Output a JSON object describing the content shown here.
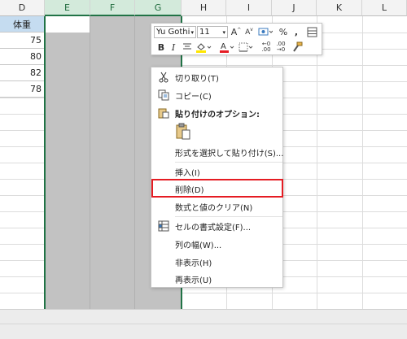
{
  "columns": [
    {
      "label": "D"
    },
    {
      "label": "E"
    },
    {
      "label": "F"
    },
    {
      "label": "G"
    },
    {
      "label": "H"
    },
    {
      "label": "I"
    },
    {
      "label": "J"
    },
    {
      "label": "K"
    },
    {
      "label": "L"
    }
  ],
  "column_d": {
    "header": "体重",
    "values": [
      "75",
      "80",
      "82",
      "78"
    ]
  },
  "mini_toolbar": {
    "font_name": "Yu Gothi",
    "font_size": "11",
    "bold": "B",
    "italic": "I",
    "percent": "%",
    "comma": ","
  },
  "context_menu": {
    "items": [
      {
        "label": "切り取り(T)",
        "icon": "scissors-icon"
      },
      {
        "label": "コピー(C)",
        "icon": "copy-icon"
      },
      {
        "label": "貼り付けのオプション:",
        "icon": "paste-options-icon"
      },
      {
        "label": "形式を選択して貼り付け(S)..."
      },
      {
        "label": "挿入(I)"
      },
      {
        "label": "削除(D)"
      },
      {
        "label": "数式と値のクリア(N)"
      },
      {
        "label": "セルの書式設定(F)...",
        "icon": "format-cells-icon"
      },
      {
        "label": "列の幅(W)..."
      },
      {
        "label": "非表示(H)"
      },
      {
        "label": "再表示(U)"
      }
    ]
  },
  "colors": {
    "selection_fill": "#c2c2c2",
    "selection_border": "#217346",
    "header_cell_fill": "#c5dcf0",
    "delete_highlight": "#e51c23",
    "font_color_red": "#e51c23",
    "highlight_yellow": "#ffe600"
  }
}
